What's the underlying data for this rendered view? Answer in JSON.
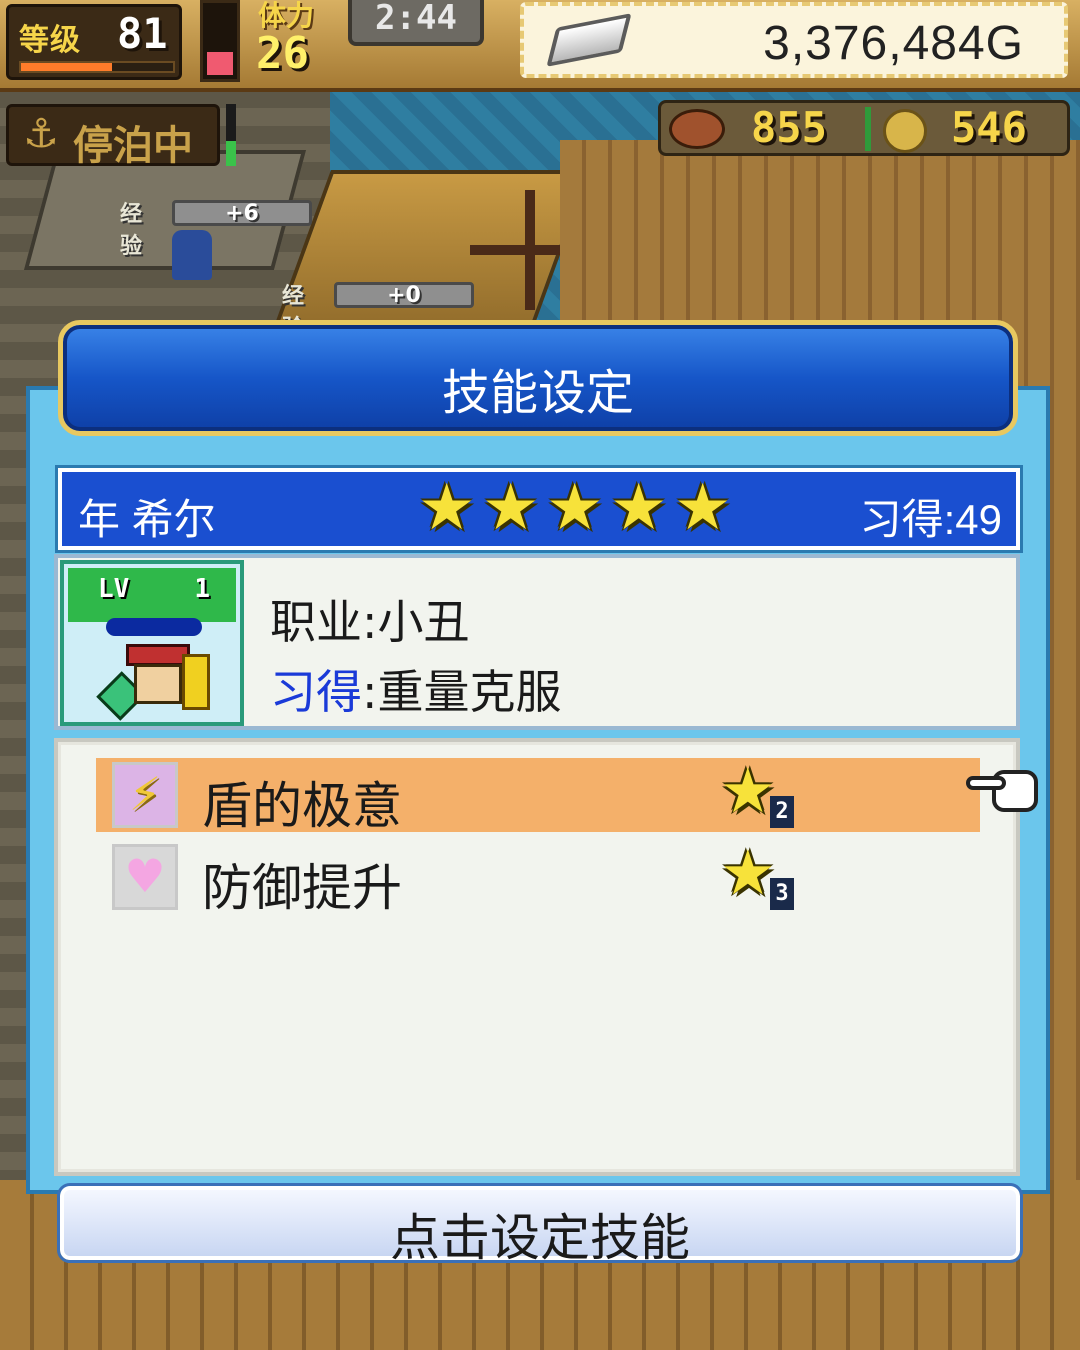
{
  "hud": {
    "level_label": "等级",
    "level_value": "81",
    "level_progress": 0.6,
    "stamina_label": "体力",
    "stamina_value": "26",
    "stamina_progress": 0.35,
    "time": "2:44",
    "gold": "3,376,484G",
    "status": "停泊中",
    "food": "855",
    "medals": "546"
  },
  "scene": {
    "exp_tags": [
      {
        "label": "经验",
        "value": "+6"
      },
      {
        "label": "经验",
        "value": "+0"
      }
    ]
  },
  "dialog": {
    "title": "技能设定",
    "character": {
      "name": "年 希尔",
      "stars": 5,
      "learned_label": "习得:49",
      "level_label": "LV",
      "level": "1",
      "job_prefix": "职业:",
      "job": "小丑",
      "learn_prefix": "习得",
      "learn_sep": ":",
      "learn_skill": "重量克服"
    },
    "skills": [
      {
        "name": "盾的极意",
        "icon": "lightning-icon",
        "grade": "2",
        "selected": true
      },
      {
        "name": "防御提升",
        "icon": "heart-icon",
        "grade": "3",
        "selected": false
      }
    ],
    "action_label": "点击设定技能"
  },
  "colors": {
    "header_blue": "#1656c8",
    "selected_row": "#f4b06a",
    "dialog_bg": "#6bc6ec",
    "star": "#f7e23a"
  }
}
